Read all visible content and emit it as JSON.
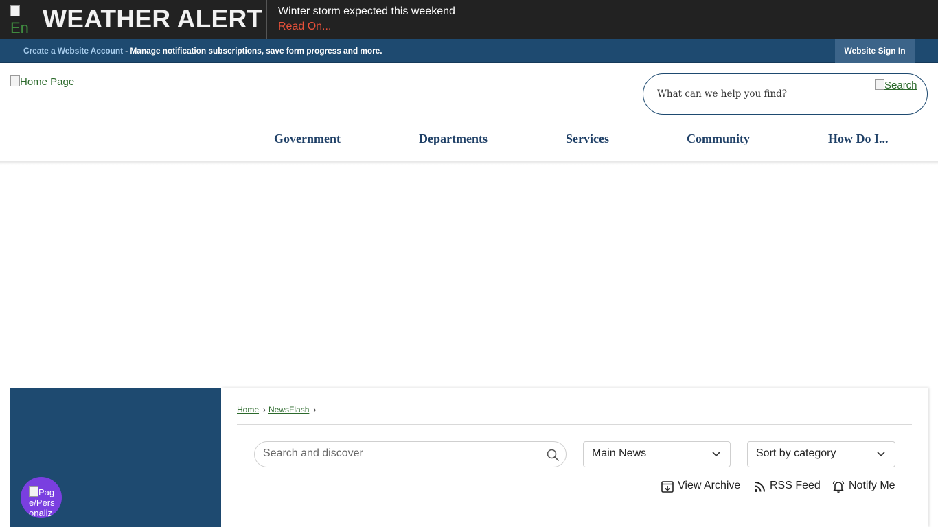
{
  "alert": {
    "icon_alt": "En",
    "title": "WEATHER ALERT",
    "message": "Winter storm expected this weekend",
    "link": "Read On..."
  },
  "account": {
    "create_link": "Create a Website Account",
    "description": " - Manage notification subscriptions, save form progress and more.",
    "sign_in": "Website Sign In"
  },
  "header": {
    "home_alt": "Home Page",
    "search_placeholder": "What can we help you find?",
    "search_alt": "Search"
  },
  "nav": {
    "items": [
      "Government",
      "Departments",
      "Services",
      "Community",
      "How Do I..."
    ]
  },
  "breadcrumb": {
    "home": "Home",
    "current": "NewsFlash",
    "separator": "›"
  },
  "filters": {
    "search_placeholder": "Search and discover",
    "category_value": "Main News",
    "sort_value": "Sort by category"
  },
  "actions": {
    "view_archive": "View Archive",
    "rss_feed": "RSS Feed",
    "notify_me": "Notify Me"
  },
  "floating": {
    "alt_text": "Page/Personalization Options"
  },
  "colors": {
    "alert_bg": "#222222",
    "alert_link": "#e8513a",
    "account_bg": "#1e4a70",
    "nav_text": "#1e3f66",
    "float_btn": "#7a3fe0",
    "link_green": "#2c6a2c"
  }
}
